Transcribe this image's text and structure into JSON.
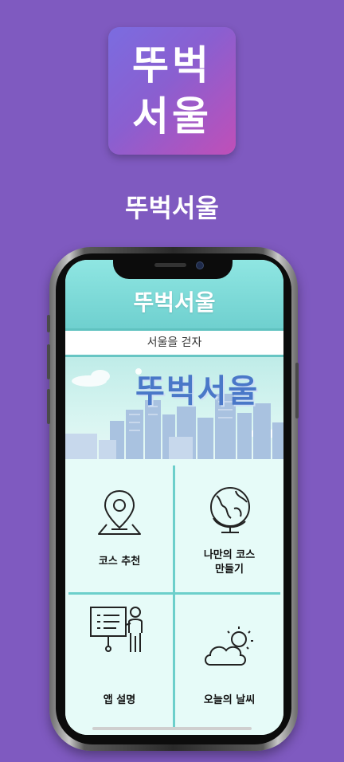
{
  "app_icon": {
    "line1": "뚜벅",
    "line2": "서울"
  },
  "app_name": "뚜벅서울",
  "screen": {
    "header_title": "뚜벅서울",
    "tagline": "서울을 걷자",
    "banner_title": "뚜벅서울"
  },
  "menu": [
    {
      "label": "코스 추천",
      "icon": "map-pin-icon"
    },
    {
      "label": "나만의 코스",
      "label2": "만들기",
      "icon": "globe-icon"
    },
    {
      "label": "앱 설명",
      "icon": "presentation-icon"
    },
    {
      "label": "오늘의 날씨",
      "icon": "weather-icon"
    }
  ],
  "colors": {
    "background": "#7f5ac0",
    "header": "#79d9d6",
    "accent": "#6ccfcb",
    "banner_text": "#4a78c8"
  }
}
